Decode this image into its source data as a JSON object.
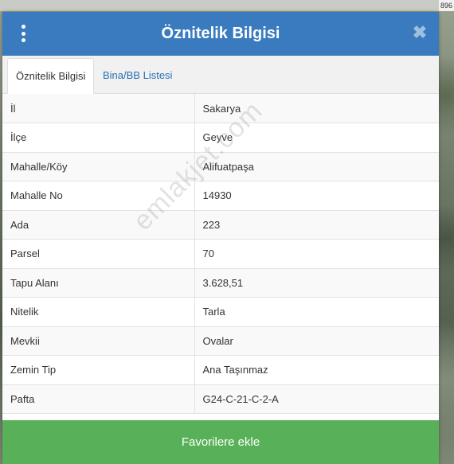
{
  "map": {
    "coordinate_fragment": "896"
  },
  "dialog": {
    "title": "Öznitelik Bilgisi",
    "close_symbol": "✖",
    "tabs": [
      {
        "label": "Öznitelik Bilgisi",
        "active": true
      },
      {
        "label": "Bina/BB Listesi",
        "active": false
      }
    ],
    "rows": [
      {
        "key": "İl",
        "value": "Sakarya"
      },
      {
        "key": "İlçe",
        "value": "Geyve"
      },
      {
        "key": "Mahalle/Köy",
        "value": "Alifuatpaşa"
      },
      {
        "key": "Mahalle No",
        "value": "14930"
      },
      {
        "key": "Ada",
        "value": "223"
      },
      {
        "key": "Parsel",
        "value": "70"
      },
      {
        "key": "Tapu Alanı",
        "value": "3.628,51"
      },
      {
        "key": "Nitelik",
        "value": "Tarla"
      },
      {
        "key": "Mevkii",
        "value": "Ovalar"
      },
      {
        "key": "Zemin Tip",
        "value": "Ana Taşınmaz"
      },
      {
        "key": "Pafta",
        "value": "G24-C-21-C-2-A"
      }
    ],
    "favorite_button": "Favorilere ekle"
  },
  "watermark": "emlakjet.com",
  "colors": {
    "header": "#3a7bbf",
    "button": "#58b158",
    "tab_link": "#2a6fb3"
  },
  "icons": [
    "vertical-dots-menu-icon",
    "close-icon"
  ]
}
